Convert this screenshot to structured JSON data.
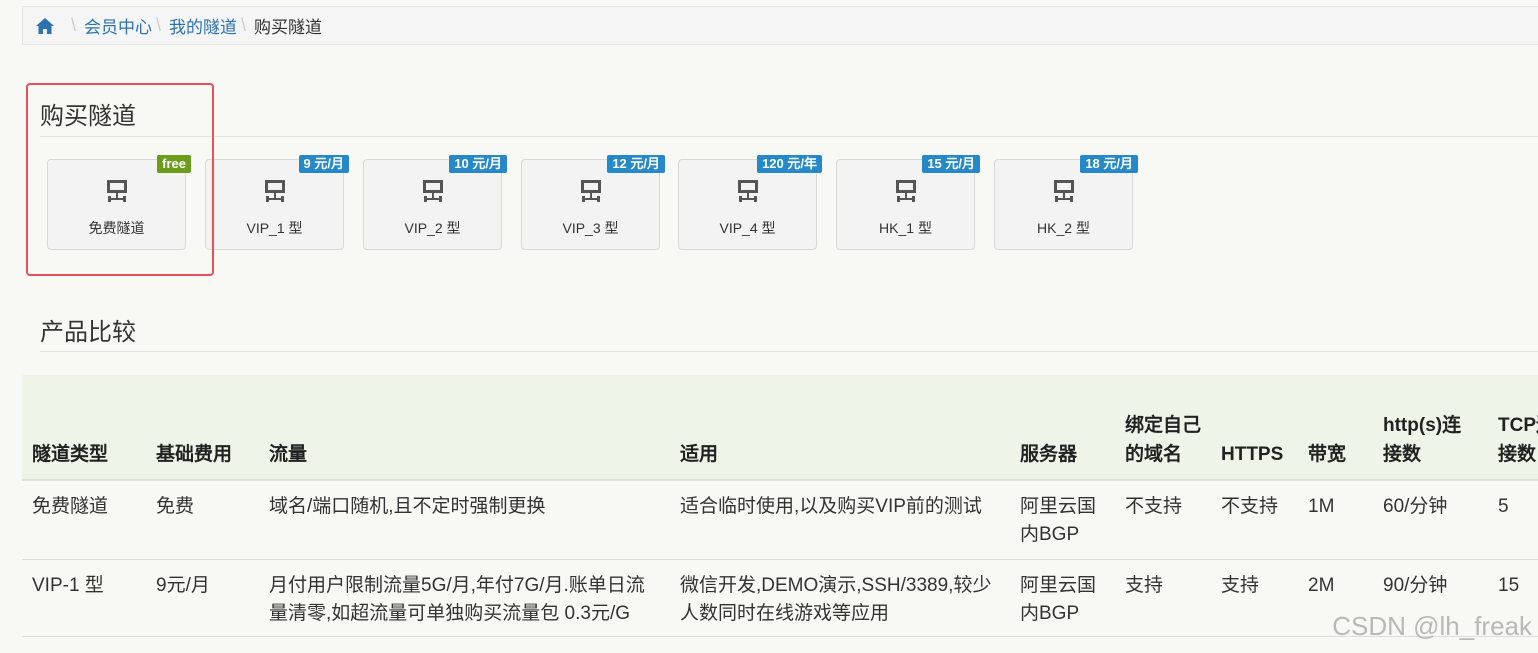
{
  "breadcrumb": {
    "home_icon": "home-icon",
    "items": [
      "会员中心",
      "我的隧道"
    ],
    "current": "购买隧道"
  },
  "buy_section": {
    "title": "购买隧道"
  },
  "plans": [
    {
      "name": "免费隧道",
      "badge": "free",
      "badge_color": "#6a9d1a",
      "icon": "network-computer-icon"
    },
    {
      "name": "VIP_1 型",
      "badge": "9 元/月",
      "badge_color": "#2588c8",
      "icon": "network-computer-icon"
    },
    {
      "name": "VIP_2 型",
      "badge": "10 元/月",
      "badge_color": "#2588c8",
      "icon": "network-computer-icon"
    },
    {
      "name": "VIP_3 型",
      "badge": "12 元/月",
      "badge_color": "#2588c8",
      "icon": "network-computer-icon"
    },
    {
      "name": "VIP_4 型",
      "badge": "120 元/年",
      "badge_color": "#2588c8",
      "icon": "network-computer-icon"
    },
    {
      "name": "HK_1 型",
      "badge": "15 元/月",
      "badge_color": "#2588c8",
      "icon": "network-computer-icon"
    },
    {
      "name": "HK_2 型",
      "badge": "18 元/月",
      "badge_color": "#2588c8",
      "icon": "network-computer-icon"
    }
  ],
  "compare_section": {
    "title": "产品比较"
  },
  "table": {
    "headers": [
      "隧道类型",
      "基础费用",
      "流量",
      "适用",
      "服务器",
      "绑定自己的域名",
      "HTTPS",
      "带宽",
      "http(s)连接数",
      "TCP连接数"
    ],
    "rows": [
      [
        "免费隧道",
        "免费",
        "域名/端口随机,且不定时强制更换",
        "适合临时使用,以及购买VIP前的测试",
        "阿里云国内BGP",
        "不支持",
        "不支持",
        "1M",
        "60/分钟",
        "5"
      ],
      [
        "VIP-1 型",
        "9元/月",
        "月付用户限制流量5G/月,年付7G/月.账单日流量清零,如超流量可单独购买流量包 0.3元/G",
        "微信开发,DEMO演示,SSH/3389,较少人数同时在线游戏等应用",
        "阿里云国内BGP",
        "支持",
        "支持",
        "2M",
        "90/分钟",
        "15"
      ]
    ]
  },
  "watermark": "CSDN @lh_freak",
  "colors": {
    "highlight_border": "#e8505f",
    "link": "#2a73b0",
    "table_header_bg": "#eef5e8"
  }
}
